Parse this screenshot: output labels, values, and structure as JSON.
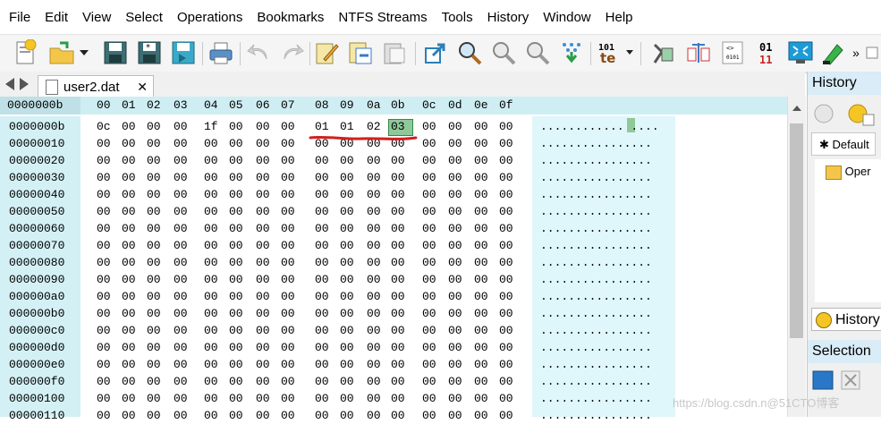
{
  "menu": [
    "File",
    "Edit",
    "View",
    "Select",
    "Operations",
    "Bookmarks",
    "NTFS Streams",
    "Tools",
    "History",
    "Window",
    "Help"
  ],
  "toolbar": {
    "icons": [
      "new-file-icon",
      "open-file-icon",
      "open-dropdown-icon",
      "save-icon",
      "save-as-icon",
      "save-all-icon",
      "print-icon",
      "undo-icon",
      "redo-icon",
      "edit-icon",
      "copy-icon",
      "paste-icon",
      "goto-icon",
      "find-icon",
      "find-previous-icon",
      "find-next-icon",
      "replace-icon",
      "insert-icon",
      "compare-icon",
      "file-info-icon",
      "binary-view-icon",
      "fullscreen-icon",
      "highlight-icon",
      "more-icon"
    ],
    "overflow": "»"
  },
  "tab": {
    "filename": "user2.dat",
    "close": "✕"
  },
  "editor": {
    "address_header": "0000000b",
    "offsets": [
      "00",
      "01",
      "02",
      "03",
      "04",
      "05",
      "06",
      "07",
      "08",
      "09",
      "0a",
      "0b",
      "0c",
      "0d",
      "0e",
      "0f"
    ],
    "rows": [
      {
        "addr": "0000000b",
        "hex": [
          "0c",
          "00",
          "00",
          "00",
          "1f",
          "00",
          "00",
          "00",
          "01",
          "01",
          "02",
          "03",
          "00",
          "00",
          "00",
          "00"
        ],
        "ascii": "............ ...."
      },
      {
        "addr": "00000010",
        "hex": [
          "00",
          "00",
          "00",
          "00",
          "00",
          "00",
          "00",
          "00",
          "00",
          "00",
          "00",
          "00",
          "00",
          "00",
          "00",
          "00"
        ],
        "ascii": "................"
      },
      {
        "addr": "00000020",
        "hex": [
          "00",
          "00",
          "00",
          "00",
          "00",
          "00",
          "00",
          "00",
          "00",
          "00",
          "00",
          "00",
          "00",
          "00",
          "00",
          "00"
        ],
        "ascii": "................"
      },
      {
        "addr": "00000030",
        "hex": [
          "00",
          "00",
          "00",
          "00",
          "00",
          "00",
          "00",
          "00",
          "00",
          "00",
          "00",
          "00",
          "00",
          "00",
          "00",
          "00"
        ],
        "ascii": "................"
      },
      {
        "addr": "00000040",
        "hex": [
          "00",
          "00",
          "00",
          "00",
          "00",
          "00",
          "00",
          "00",
          "00",
          "00",
          "00",
          "00",
          "00",
          "00",
          "00",
          "00"
        ],
        "ascii": "................"
      },
      {
        "addr": "00000050",
        "hex": [
          "00",
          "00",
          "00",
          "00",
          "00",
          "00",
          "00",
          "00",
          "00",
          "00",
          "00",
          "00",
          "00",
          "00",
          "00",
          "00"
        ],
        "ascii": "................"
      },
      {
        "addr": "00000060",
        "hex": [
          "00",
          "00",
          "00",
          "00",
          "00",
          "00",
          "00",
          "00",
          "00",
          "00",
          "00",
          "00",
          "00",
          "00",
          "00",
          "00"
        ],
        "ascii": "................"
      },
      {
        "addr": "00000070",
        "hex": [
          "00",
          "00",
          "00",
          "00",
          "00",
          "00",
          "00",
          "00",
          "00",
          "00",
          "00",
          "00",
          "00",
          "00",
          "00",
          "00"
        ],
        "ascii": "................"
      },
      {
        "addr": "00000080",
        "hex": [
          "00",
          "00",
          "00",
          "00",
          "00",
          "00",
          "00",
          "00",
          "00",
          "00",
          "00",
          "00",
          "00",
          "00",
          "00",
          "00"
        ],
        "ascii": "................"
      },
      {
        "addr": "00000090",
        "hex": [
          "00",
          "00",
          "00",
          "00",
          "00",
          "00",
          "00",
          "00",
          "00",
          "00",
          "00",
          "00",
          "00",
          "00",
          "00",
          "00"
        ],
        "ascii": "................"
      },
      {
        "addr": "000000a0",
        "hex": [
          "00",
          "00",
          "00",
          "00",
          "00",
          "00",
          "00",
          "00",
          "00",
          "00",
          "00",
          "00",
          "00",
          "00",
          "00",
          "00"
        ],
        "ascii": "................"
      },
      {
        "addr": "000000b0",
        "hex": [
          "00",
          "00",
          "00",
          "00",
          "00",
          "00",
          "00",
          "00",
          "00",
          "00",
          "00",
          "00",
          "00",
          "00",
          "00",
          "00"
        ],
        "ascii": "................"
      },
      {
        "addr": "000000c0",
        "hex": [
          "00",
          "00",
          "00",
          "00",
          "00",
          "00",
          "00",
          "00",
          "00",
          "00",
          "00",
          "00",
          "00",
          "00",
          "00",
          "00"
        ],
        "ascii": "................"
      },
      {
        "addr": "000000d0",
        "hex": [
          "00",
          "00",
          "00",
          "00",
          "00",
          "00",
          "00",
          "00",
          "00",
          "00",
          "00",
          "00",
          "00",
          "00",
          "00",
          "00"
        ],
        "ascii": "................"
      },
      {
        "addr": "000000e0",
        "hex": [
          "00",
          "00",
          "00",
          "00",
          "00",
          "00",
          "00",
          "00",
          "00",
          "00",
          "00",
          "00",
          "00",
          "00",
          "00",
          "00"
        ],
        "ascii": "................"
      },
      {
        "addr": "000000f0",
        "hex": [
          "00",
          "00",
          "00",
          "00",
          "00",
          "00",
          "00",
          "00",
          "00",
          "00",
          "00",
          "00",
          "00",
          "00",
          "00",
          "00"
        ],
        "ascii": "................"
      },
      {
        "addr": "00000100",
        "hex": [
          "00",
          "00",
          "00",
          "00",
          "00",
          "00",
          "00",
          "00",
          "00",
          "00",
          "00",
          "00",
          "00",
          "00",
          "00",
          "00"
        ],
        "ascii": "................"
      },
      {
        "addr": "00000110",
        "hex": [
          "00",
          "00",
          "00",
          "00",
          "00",
          "00",
          "00",
          "00",
          "00",
          "00",
          "00",
          "00",
          "00",
          "00",
          "00",
          "00"
        ],
        "ascii": "................"
      }
    ],
    "selected_byte": "03"
  },
  "panels": {
    "history_title": "History",
    "default_tab": "Default",
    "history_item": "Oper",
    "history_button": "History",
    "selection_title": "Selection"
  },
  "watermark": "https://blog.csdn.n@51CTO博客",
  "colors": {
    "accent_header": "#cfeef3",
    "address_bg": "#d3f0f5",
    "selection_green": "#8fc99a",
    "annotation_red": "#d21f1f"
  }
}
